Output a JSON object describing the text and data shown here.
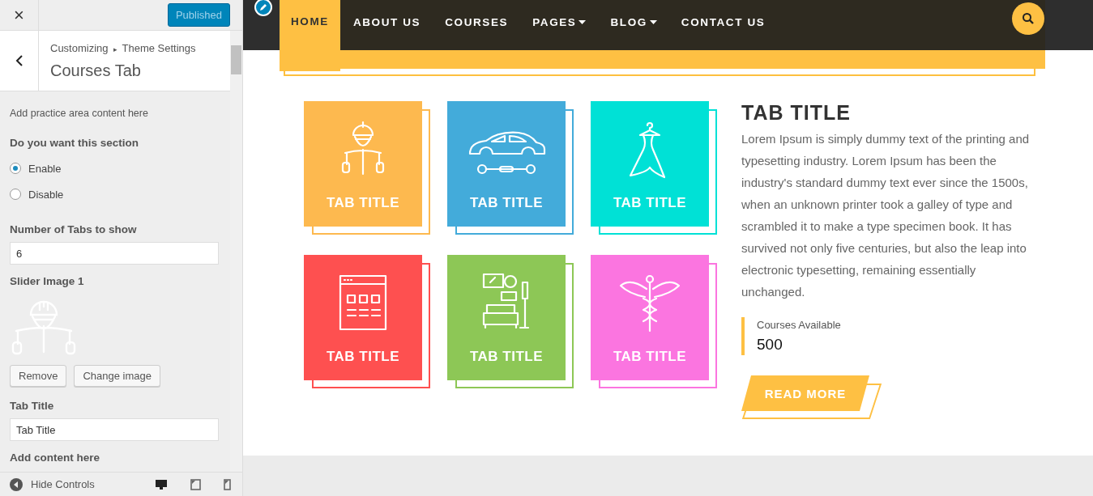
{
  "sidebar": {
    "close_label": "×",
    "publish_button": "Published",
    "breadcrumb": [
      "Customizing",
      "Theme Settings"
    ],
    "breadcrumb_separator": "▸",
    "panel_title": "Courses Tab",
    "description": "Add practice area content here",
    "section_question": "Do you want this section",
    "radios": [
      {
        "label": "Enable",
        "selected": true
      },
      {
        "label": "Disable",
        "selected": false
      }
    ],
    "tabs_count_label": "Number of Tabs to show",
    "tabs_count_value": "6",
    "image_label": "Slider Image 1",
    "image_buttons": [
      "Remove",
      "Change image"
    ],
    "tab_title_label": "Tab Title",
    "tab_title_value": "Tab Title",
    "content_label": "Add content here",
    "hide_controls": "Hide Controls",
    "devices": [
      {
        "kind": "desktop",
        "selected": true
      },
      {
        "kind": "tablet",
        "selected": false
      },
      {
        "kind": "mobile",
        "selected": false
      }
    ]
  },
  "nav": [
    {
      "label": "HOME",
      "selected": true,
      "dropdown": false
    },
    {
      "label": "ABOUT US",
      "selected": false,
      "dropdown": false
    },
    {
      "label": "COURSES",
      "selected": false,
      "dropdown": false
    },
    {
      "label": "PAGES",
      "selected": false,
      "dropdown": true
    },
    {
      "label": "BLOG",
      "selected": false,
      "dropdown": true
    },
    {
      "label": "CONTACT US",
      "selected": false,
      "dropdown": false
    }
  ],
  "tiles": [
    {
      "title": "TAB TITLE",
      "kind": "engineer",
      "color": "#fdb94f"
    },
    {
      "title": "TAB TITLE",
      "kind": "car",
      "color": "#43abda"
    },
    {
      "title": "TAB TITLE",
      "kind": "dress",
      "color": "#00e1d6"
    },
    {
      "title": "TAB TITLE",
      "kind": "browser",
      "color": "#fe5050"
    },
    {
      "title": "TAB TITLE",
      "kind": "interior",
      "color": "#8dc756"
    },
    {
      "title": "TAB TITLE",
      "kind": "medical",
      "color": "#fb75e0"
    }
  ],
  "detail": {
    "title": "TAB TITLE",
    "body": "Lorem Ipsum is simply dummy text of the printing and typesetting industry. Lorem Ipsum has been the industry's standard dummy text ever since the 1500s, when an unknown printer took a galley of type and scrambled it to make a type specimen book. It has survived not only five centuries, but also the leap into electronic typesetting, remaining essentially unchanged.",
    "stat_label": "Courses Available",
    "stat_value": "500",
    "button": "READ MORE"
  }
}
